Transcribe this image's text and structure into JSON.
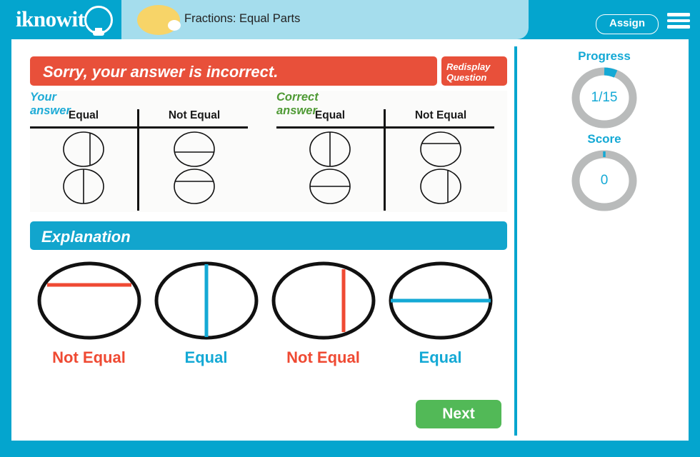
{
  "header": {
    "logo_text": "iknowit",
    "logo_icon": "lightbulb-icon",
    "lesson_title": "Fractions: Equal Parts",
    "assign_label": "Assign",
    "menu_icon": "hamburger-menu-icon"
  },
  "result": {
    "message": "Sorry, your answer is incorrect.",
    "redisplay_line1": "Redisplay",
    "redisplay_line2": "Question",
    "banner_color": "#e8503a"
  },
  "answers": {
    "your_label": "Your answer",
    "correct_label": "Correct answer",
    "columns": [
      "Equal",
      "Not Equal"
    ],
    "your": {
      "equal": [
        {
          "orientation": "vertical",
          "offset": "off-center"
        },
        {
          "orientation": "vertical",
          "offset": "center"
        }
      ],
      "not_equal": [
        {
          "orientation": "horizontal",
          "offset": "below-center"
        },
        {
          "orientation": "horizontal",
          "offset": "above-center"
        }
      ]
    },
    "correct": {
      "equal": [
        {
          "orientation": "vertical",
          "offset": "center"
        },
        {
          "orientation": "horizontal",
          "offset": "center"
        }
      ],
      "not_equal": [
        {
          "orientation": "horizontal",
          "offset": "above-center"
        },
        {
          "orientation": "vertical",
          "offset": "off-center"
        }
      ]
    }
  },
  "explanation": {
    "title": "Explanation",
    "items": [
      {
        "label": "Not Equal",
        "color": "#ef4a33",
        "orientation": "horizontal",
        "offset": "above-center"
      },
      {
        "label": "Equal",
        "color": "#14a9d5",
        "orientation": "vertical",
        "offset": "center"
      },
      {
        "label": "Not Equal",
        "color": "#ef4a33",
        "orientation": "vertical",
        "offset": "off-center"
      },
      {
        "label": "Equal",
        "color": "#14a9d5",
        "orientation": "horizontal",
        "offset": "center"
      }
    ]
  },
  "next_button": {
    "label": "Next",
    "color": "#52b957"
  },
  "sidebar": {
    "progress": {
      "title": "Progress",
      "value_text": "1/15",
      "current": 1,
      "total": 15,
      "percent": 6.7
    },
    "score": {
      "title": "Score",
      "value_text": "0",
      "percent": 0
    },
    "accent_color": "#14a9d5",
    "track_color": "#b9bbbb"
  }
}
